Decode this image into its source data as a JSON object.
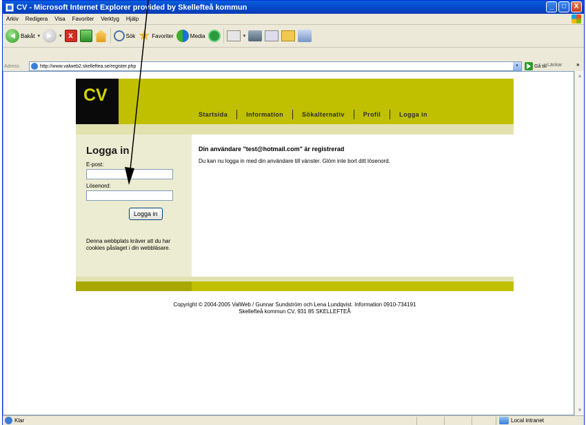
{
  "window": {
    "title": "CV - Microsoft Internet Explorer provided by Skellefteå kommun",
    "controls": [
      "_",
      "□",
      "X"
    ]
  },
  "menu": [
    "Arkiv",
    "Redigera",
    "Visa",
    "Favoriter",
    "Verktyg",
    "Hjälp"
  ],
  "toolbar": {
    "back_label": "Bakåt",
    "search_label": "Sök",
    "favorites_label": "Favoriter",
    "media_label": "Media",
    "stop_glyph": "x"
  },
  "address": {
    "label": "Adress",
    "url": "http://www.valweb2.skelleftea.se/register.php",
    "go_label": "Gå till",
    "links_label": "Länkar",
    "links_chevron": "»"
  },
  "site": {
    "logo": "CV",
    "nav": [
      "Startsida",
      "Information",
      "Sökalternativ",
      "Profil",
      "Logga in"
    ],
    "login": {
      "title": "Logga in",
      "email_label": "E-post:",
      "password_label": "Lösenord:",
      "button": "Logga in",
      "cookie_note": "Denna webbplats kräver att du har cookies påslaget i din webbläsare."
    },
    "message": {
      "title": "Din användare \"test@hotmail.com\" är registrerad",
      "text": "Du kan nu logga in med din användare till vänster. Glöm inte bort ditt lösenord."
    },
    "copyright_line1": "Copyright © 2004-2005 ValWeb / Gunnar Sundström och Lena Lundqvist. Information 0910-734191",
    "copyright_line2": "Skellefteå kommun CV, 931 85 SKELLEFTEÅ"
  },
  "status": {
    "text": "Klar",
    "zone": "Local intranet"
  }
}
